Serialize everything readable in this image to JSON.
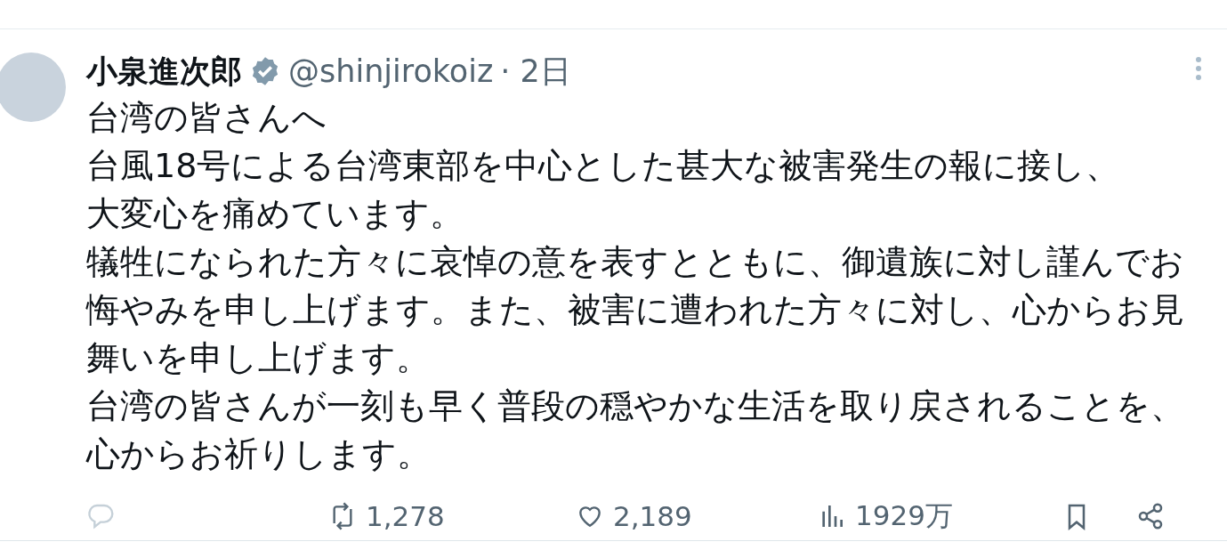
{
  "tweet": {
    "author": {
      "name": "小泉進次郎",
      "verified": true,
      "handle": "@shinjirokoiz",
      "time": "· 2日"
    },
    "paragraphs": [
      "台湾の皆さんへ",
      "台風18号による台湾東部を中心とした甚大な被害発生の報に接し、",
      "大変心を痛めています。",
      "犠牲になられた方々に哀悼の意を表すとともに、御遺族に対し謹んでお悔やみを申し上げます。また、被害に遭われた方々に対し、心からお見舞いを申し上げます。",
      "台湾の皆さんが一刻も早く普段の穏やかな生活を取り戻されることを、心からお祈りします。"
    ],
    "actions": [
      {
        "kind": "reply"
      },
      {
        "kind": "repost",
        "count": "1,278"
      },
      {
        "kind": "like",
        "count": "2,189"
      },
      {
        "kind": "views",
        "count": "1929万"
      },
      {
        "kind": "bookmark"
      },
      {
        "kind": "share"
      }
    ]
  }
}
